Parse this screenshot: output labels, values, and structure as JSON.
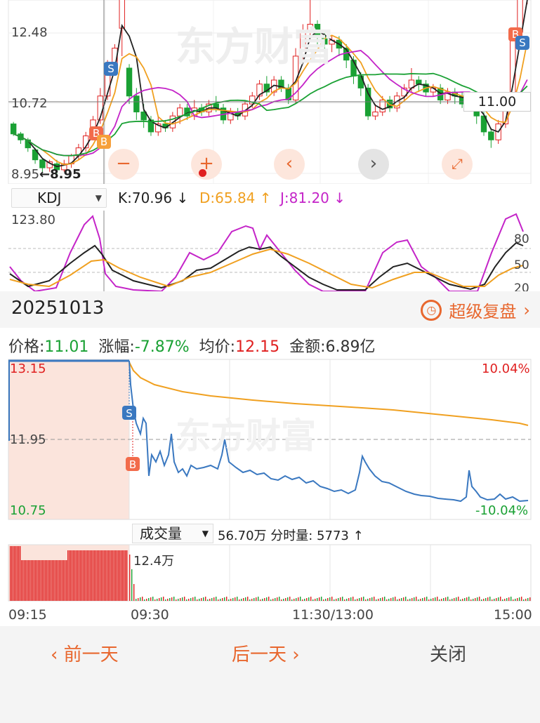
{
  "kline": {
    "price_high_label": "12.48",
    "price_mid_label": "10.72",
    "price_low_label": "8.95",
    "low_marker": "←8.95",
    "crosshair_value": "11.00",
    "watermark": "东方财富",
    "candles": [
      [
        10.2,
        9.95,
        10.25,
        9.9
      ],
      [
        9.95,
        9.8,
        10.0,
        9.7
      ],
      [
        9.8,
        9.6,
        9.85,
        9.5
      ],
      [
        9.55,
        9.3,
        9.6,
        9.2
      ],
      [
        9.3,
        9.1,
        9.35,
        9.0
      ],
      [
        9.1,
        9.25,
        9.3,
        9.0
      ],
      [
        9.2,
        9.05,
        9.3,
        8.95
      ],
      [
        9.05,
        9.2,
        9.3,
        9.0
      ],
      [
        9.2,
        9.4,
        9.45,
        9.1
      ],
      [
        9.4,
        9.6,
        9.7,
        9.3
      ],
      [
        9.6,
        9.9,
        10.0,
        9.5
      ],
      [
        9.9,
        10.3,
        10.4,
        9.8
      ],
      [
        10.3,
        10.9,
        11.1,
        10.2
      ],
      [
        10.9,
        11.7,
        11.8,
        10.8
      ],
      [
        11.7,
        12.1,
        12.2,
        11.6
      ],
      [
        12.6,
        14.2,
        14.4,
        11.9
      ],
      [
        11.6,
        10.9,
        11.7,
        10.7
      ],
      [
        10.9,
        10.5,
        11.1,
        10.3
      ],
      [
        10.5,
        10.3,
        10.7,
        10.1
      ],
      [
        10.3,
        10.0,
        10.4,
        9.9
      ],
      [
        10.0,
        10.2,
        10.4,
        9.9
      ],
      [
        10.2,
        10.1,
        10.3,
        10.0
      ],
      [
        10.1,
        10.4,
        10.5,
        10.0
      ],
      [
        10.4,
        10.6,
        10.7,
        10.2
      ],
      [
        10.6,
        10.4,
        10.7,
        10.3
      ],
      [
        10.4,
        10.6,
        10.8,
        10.3
      ],
      [
        10.6,
        10.5,
        10.7,
        10.4
      ],
      [
        10.5,
        10.7,
        10.8,
        10.4
      ],
      [
        10.7,
        10.6,
        10.9,
        10.5
      ],
      [
        10.6,
        10.3,
        10.7,
        10.2
      ],
      [
        10.3,
        10.5,
        10.6,
        10.2
      ],
      [
        10.5,
        10.4,
        10.6,
        10.3
      ],
      [
        10.4,
        10.7,
        10.8,
        10.3
      ],
      [
        10.7,
        10.9,
        11.0,
        10.6
      ],
      [
        10.9,
        11.2,
        11.3,
        10.8
      ],
      [
        11.2,
        11.0,
        11.4,
        10.9
      ],
      [
        11.0,
        11.3,
        11.4,
        10.9
      ],
      [
        11.3,
        11.1,
        11.4,
        11.0
      ],
      [
        11.1,
        10.8,
        11.2,
        10.7
      ],
      [
        10.8,
        11.9,
        12.1,
        10.7
      ],
      [
        11.9,
        12.5,
        12.7,
        11.8
      ],
      [
        12.5,
        12.7,
        13.5,
        12.3
      ],
      [
        12.7,
        12.4,
        12.8,
        12.2
      ],
      [
        12.4,
        12.2,
        12.5,
        12.0
      ],
      [
        12.2,
        12.3,
        12.4,
        12.0
      ],
      [
        12.3,
        12.1,
        12.4,
        11.9
      ],
      [
        12.1,
        11.8,
        12.2,
        11.6
      ],
      [
        11.8,
        11.4,
        11.9,
        11.2
      ],
      [
        11.4,
        11.1,
        11.5,
        10.9
      ],
      [
        11.1,
        10.4,
        11.2,
        10.3
      ],
      [
        10.4,
        10.5,
        10.7,
        10.3
      ],
      [
        10.5,
        10.8,
        10.9,
        10.4
      ],
      [
        10.8,
        10.6,
        10.9,
        10.5
      ],
      [
        10.6,
        10.9,
        11.0,
        10.5
      ],
      [
        10.9,
        11.1,
        11.2,
        10.8
      ],
      [
        11.1,
        11.3,
        11.6,
        11.0
      ],
      [
        11.3,
        11.2,
        11.4,
        11.0
      ],
      [
        11.2,
        11.0,
        11.3,
        10.9
      ],
      [
        11.0,
        11.1,
        11.2,
        10.9
      ],
      [
        11.1,
        10.8,
        11.2,
        10.7
      ],
      [
        10.8,
        11.0,
        11.1,
        10.7
      ],
      [
        11.0,
        10.9,
        11.1,
        10.7
      ],
      [
        10.9,
        10.7,
        11.0,
        10.6
      ],
      [
        10.7,
        10.9,
        11.0,
        10.6
      ],
      [
        10.9,
        10.4,
        11.0,
        10.2
      ],
      [
        10.4,
        10.0,
        10.5,
        9.9
      ],
      [
        10.0,
        9.8,
        10.1,
        9.6
      ],
      [
        9.8,
        10.2,
        10.3,
        9.7
      ],
      [
        10.2,
        10.8,
        10.9,
        10.1
      ],
      [
        10.8,
        12.5,
        12.6,
        10.7
      ],
      [
        12.5,
        13.4,
        14.4,
        12.3
      ],
      [
        13.4,
        14.4,
        14.5,
        13.2
      ]
    ]
  },
  "kdj": {
    "selector_label": "KDJ",
    "k_text": "K:70.96 ↓",
    "d_text": "D:65.84 ↑",
    "j_text": "J:81.20 ↓",
    "top_label": "123.80",
    "levels": [
      "80",
      "50",
      "20"
    ]
  },
  "day": {
    "date": "20251013",
    "replay_label": "超级复盘",
    "price_label": "价格:",
    "price_value": "11.01",
    "change_label": "涨幅:",
    "change_value": "-7.87%",
    "avg_label": "均价:",
    "avg_value": "12.15",
    "amount_label": "金额:",
    "amount_value": "6.89亿",
    "high_label": "13.15",
    "mid_label": "11.95",
    "low_label": "10.75",
    "high_pct": "10.04%",
    "low_pct": "-10.04%",
    "volume_selector": "成交量",
    "volume_total": "56.70万",
    "minute_volume": "分时量: 5773 ↑",
    "volume_peak": "12.4万",
    "times": [
      "09:15",
      "09:30",
      "11:30/13:00",
      "15:00"
    ]
  },
  "buttons": {
    "prev": "前一天",
    "next": "后一天",
    "close": "关闭"
  },
  "colors": {
    "up": "#e02020",
    "down": "#1aa134",
    "accent": "#e8672e"
  }
}
